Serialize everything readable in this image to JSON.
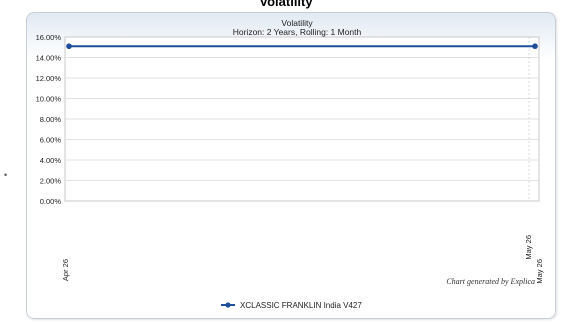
{
  "header": {
    "title": "Volatility"
  },
  "chart_data": {
    "type": "line",
    "title": "Volatility",
    "subtitle": "Horizon: 2 Years, Rolling: 1 Month",
    "xlabel": "",
    "ylabel": "",
    "x_categories": [
      "Apr 26",
      "May 26"
    ],
    "ylim": [
      0,
      16
    ],
    "y_ticks": [
      0,
      2,
      4,
      6,
      8,
      10,
      12,
      14,
      16
    ],
    "y_tick_labels": [
      "0.00%",
      "2.00%",
      "4.00%",
      "6.00%",
      "8.00%",
      "10.00%",
      "12.00%",
      "14.00%",
      "16.00%"
    ],
    "grid": true,
    "legend_position": "bottom",
    "credit": "Chart generated by Explica",
    "series": [
      {
        "name": "XCLASSIC FRANKLIN India V427",
        "x": [
          "Apr 26",
          "May 26"
        ],
        "values": [
          15.1,
          15.1
        ],
        "color": "#1f4e9c"
      }
    ]
  }
}
